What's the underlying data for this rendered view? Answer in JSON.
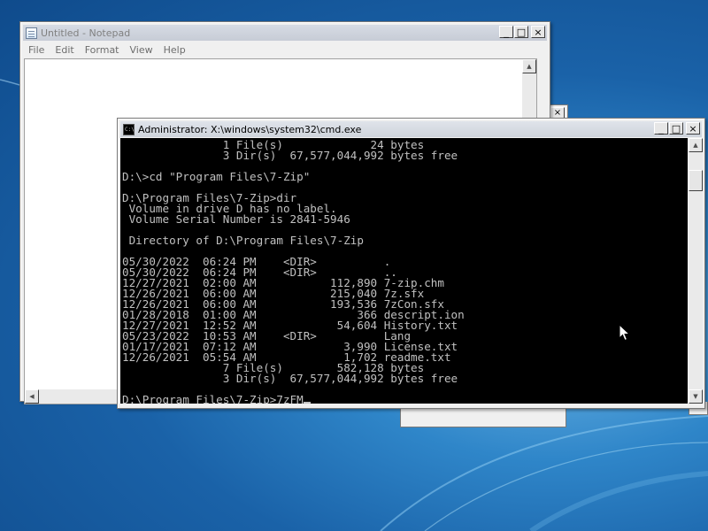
{
  "notepad": {
    "title": "Untitled - Notepad",
    "menu": [
      "File",
      "Edit",
      "Format",
      "View",
      "Help"
    ],
    "buttons": {
      "minimize": "_",
      "maximize": "□",
      "close": "×"
    }
  },
  "cmd": {
    "title": "Administrator: X:\\windows\\system32\\cmd.exe",
    "buttons": {
      "minimize": "_",
      "maximize": "□",
      "close": "×"
    },
    "lines": [
      "               1 File(s)             24 bytes",
      "               3 Dir(s)  67,577,044,992 bytes free",
      "",
      "D:\\>cd \"Program Files\\7-Zip\"",
      "",
      "D:\\Program Files\\7-Zip>dir",
      " Volume in drive D has no label.",
      " Volume Serial Number is 2841-5946",
      "",
      " Directory of D:\\Program Files\\7-Zip",
      "",
      "05/30/2022  06:24 PM    <DIR>          .",
      "05/30/2022  06:24 PM    <DIR>          ..",
      "12/27/2021  02:00 AM           112,890 7-zip.chm",
      "12/26/2021  06:00 AM           215,040 7z.sfx",
      "12/26/2021  06:00 AM           193,536 7zCon.sfx",
      "01/28/2018  01:00 AM               366 descript.ion",
      "12/27/2021  12:52 AM            54,604 History.txt",
      "05/23/2022  10:53 AM    <DIR>          Lang",
      "01/17/2021  07:12 AM             3,990 License.txt",
      "12/26/2021  05:54 AM             1,702 readme.txt",
      "               7 File(s)        582,128 bytes",
      "               3 Dir(s)  67,577,044,992 bytes free",
      ""
    ],
    "prompt": "D:\\Program Files\\7-Zip>7zFM"
  },
  "icons": [
    "notepad-icon",
    "cmd-icon",
    "minimize-icon",
    "maximize-icon",
    "close-icon",
    "scroll-up-icon",
    "scroll-down-icon",
    "scroll-left-icon",
    "mouse-pointer-icon"
  ],
  "colors": {
    "console_bg": "#000000",
    "console_fg": "#c0c0c0",
    "desktop": "#1a62a8"
  }
}
